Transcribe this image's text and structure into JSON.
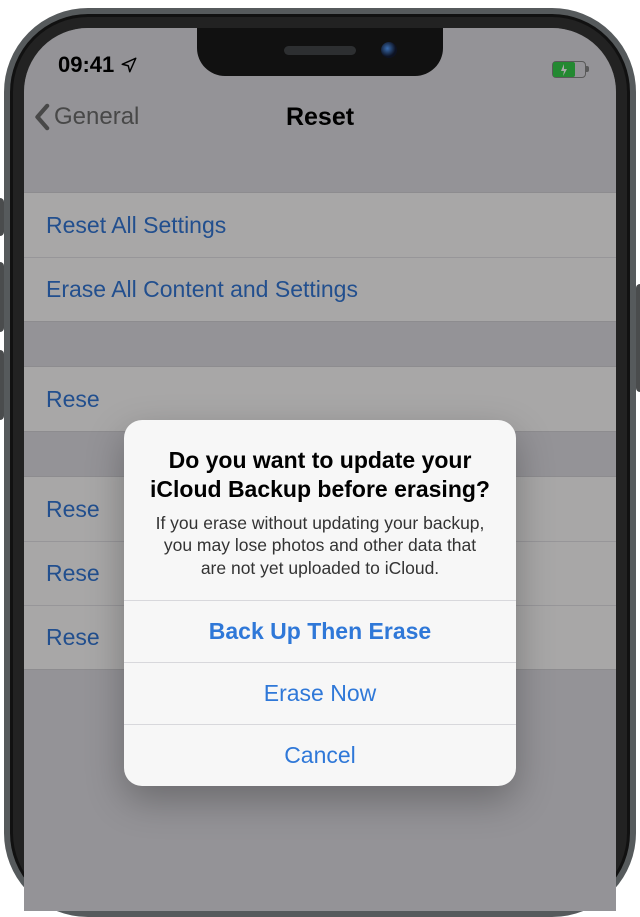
{
  "status": {
    "time": "09:41",
    "location_icon": "location-arrow"
  },
  "nav": {
    "back_label": "General",
    "title": "Reset"
  },
  "lists": {
    "group1": [
      {
        "label": "Reset All Settings"
      },
      {
        "label": "Erase All Content and Settings"
      }
    ],
    "group2": [
      {
        "label": "Rese"
      },
      {
        "label": "Rese"
      },
      {
        "label": "Rese"
      },
      {
        "label": "Rese"
      }
    ]
  },
  "alert": {
    "title": "Do you want to update your iCloud Backup before erasing?",
    "message": "If you erase without updating your backup, you may lose photos and other data that are not yet uploaded to iCloud.",
    "actions": {
      "primary": "Back Up Then Erase",
      "secondary": "Erase Now",
      "cancel": "Cancel"
    }
  }
}
